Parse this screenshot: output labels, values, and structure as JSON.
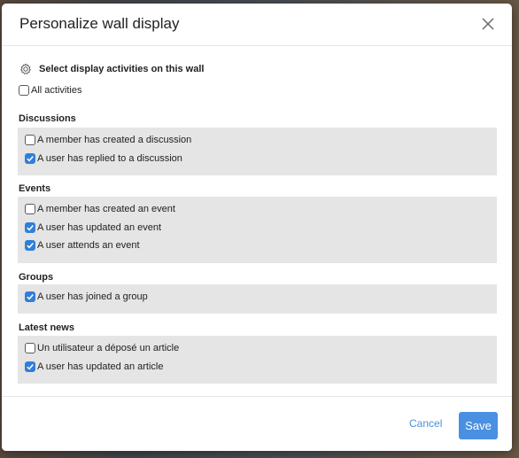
{
  "dialog": {
    "title": "Personalize wall display"
  },
  "instructions": "Select display activities on this wall",
  "all_activities": {
    "label": "All activities",
    "checked": false
  },
  "sections": [
    {
      "title": "Discussions",
      "items": [
        {
          "label": "A member has created a discussion",
          "checked": false
        },
        {
          "label": "A user has replied to a discussion",
          "checked": true
        }
      ]
    },
    {
      "title": "Events",
      "items": [
        {
          "label": "A member has created an event",
          "checked": false
        },
        {
          "label": "A user has updated an event",
          "checked": true
        },
        {
          "label": "A user attends an event",
          "checked": true
        }
      ]
    },
    {
      "title": "Groups",
      "items": [
        {
          "label": "A user has joined a group",
          "checked": true
        }
      ]
    },
    {
      "title": "Latest news",
      "items": [
        {
          "label": "Un utilisateur a déposé un article",
          "checked": false
        },
        {
          "label": "A user has updated an article",
          "checked": true
        }
      ]
    }
  ],
  "footer": {
    "cancel_label": "Cancel",
    "save_label": "Save"
  },
  "colors": {
    "accent": "#4a90e2",
    "checkbox_checked": "#2f7fd9",
    "section_bg": "#e5e5e5"
  }
}
